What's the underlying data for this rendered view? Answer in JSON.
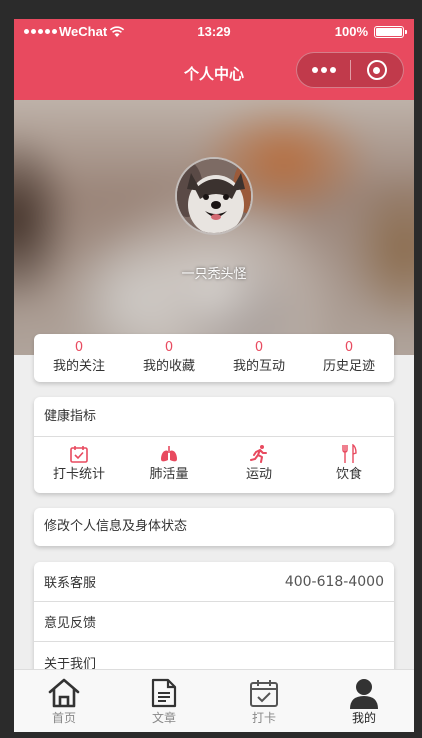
{
  "status_bar": {
    "carrier": "WeChat",
    "time": "13:29",
    "battery": "100%"
  },
  "nav": {
    "title": "个人中心"
  },
  "profile": {
    "nickname": "一只秃头怪"
  },
  "stats": [
    {
      "value": "0",
      "label": "我的关注"
    },
    {
      "value": "0",
      "label": "我的收藏"
    },
    {
      "value": "0",
      "label": "我的互动"
    },
    {
      "value": "0",
      "label": "历史足迹"
    }
  ],
  "health": {
    "title": "健康指标",
    "items": [
      {
        "label": "打卡统计",
        "icon": "calendar-check-icon"
      },
      {
        "label": "肺活量",
        "icon": "lungs-icon"
      },
      {
        "label": "运动",
        "icon": "running-icon"
      },
      {
        "label": "饮食",
        "icon": "fork-knife-icon"
      }
    ]
  },
  "edit_profile": {
    "label": "修改个人信息及身体状态"
  },
  "menu": {
    "service_label": "联系客服",
    "service_phone": "400-618-4000",
    "feedback_label": "意见反馈",
    "about_label": "关于我们"
  },
  "tabbar": [
    {
      "label": "首页",
      "icon": "home-icon",
      "active": false
    },
    {
      "label": "文章",
      "icon": "article-icon",
      "active": false
    },
    {
      "label": "打卡",
      "icon": "checkin-icon",
      "active": false
    },
    {
      "label": "我的",
      "icon": "user-icon",
      "active": true
    }
  ],
  "colors": {
    "accent": "#e84a5f",
    "background": "#eeeeee"
  }
}
